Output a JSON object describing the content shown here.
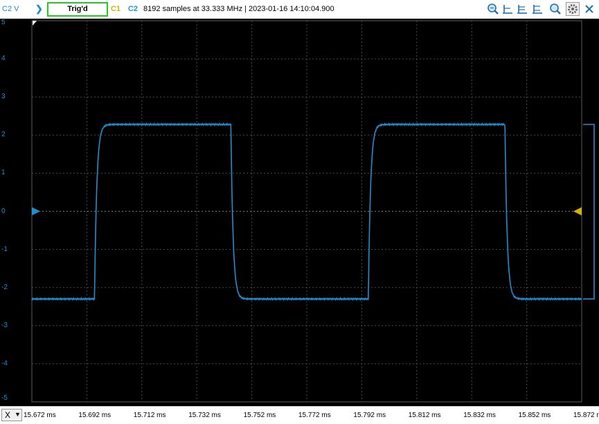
{
  "header": {
    "axis_title": "C2 V",
    "run_icon": "chevron-right-icon",
    "trigger_status": "Trig'd",
    "channel1": "C1",
    "channel2": "C2",
    "acquisition_info": "8192 samples at 33.333 MHz | 2023-01-16 14:10:04.900",
    "tool_icons": [
      "zoom-fit-icon",
      "cursor-icon",
      "cursor-icon",
      "cursor-icon",
      "zoom-in-icon",
      "gear-icon",
      "close-icon"
    ]
  },
  "y_axis": {
    "ticks": [
      "5",
      "4",
      "3",
      "2",
      "1",
      "0",
      "-1",
      "-2",
      "-3",
      "-4",
      "-5"
    ]
  },
  "x_axis": {
    "selector": "X",
    "ticks": [
      "15.672 ms",
      "15.692 ms",
      "15.712 ms",
      "15.732 ms",
      "15.752 ms",
      "15.772 ms",
      "15.792 ms",
      "15.812 ms",
      "15.832 ms",
      "15.852 ms",
      "15.872 m"
    ]
  },
  "colors": {
    "channel1": "#d8b000",
    "channel2": "#1e90d0",
    "trigger_ok": "#22cc22",
    "background": "#000000"
  },
  "trace": {
    "channel": "C2",
    "low_level": -2.3,
    "high_level": 2.28,
    "edges": [
      {
        "type": "rise",
        "time_ms": 15.6948
      },
      {
        "type": "fall",
        "time_ms": 15.7444
      },
      {
        "type": "rise",
        "time_ms": 15.7944
      },
      {
        "type": "fall",
        "time_ms": 15.8441
      }
    ]
  }
}
